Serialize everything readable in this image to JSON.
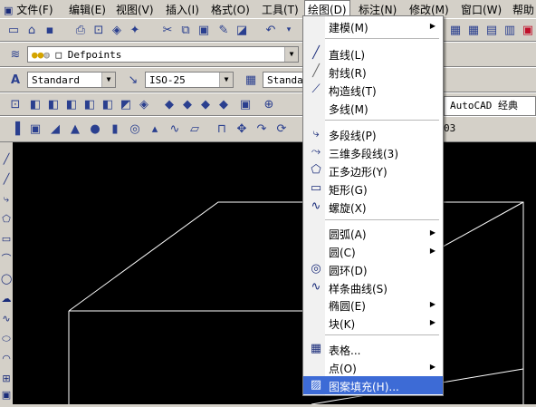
{
  "menubar": {
    "items": [
      "文件(F)",
      "编辑(E)",
      "视图(V)",
      "插入(I)",
      "格式(O)",
      "工具(T)",
      "绘图(D)",
      "标注(N)",
      "修改(M)",
      "窗口(W)",
      "帮助"
    ],
    "active_index": 6
  },
  "toolbars": {
    "layer_combo": "Defpoints",
    "text_style_combo": "Standard",
    "dim_style_combo": "ISO-25",
    "table_style_combo": "Standar",
    "workspace_combo": "AutoCAD 经典",
    "layer_icon_name": "layer-icon"
  },
  "draw_menu": {
    "items": [
      {
        "label": "建模(M)",
        "icon": "",
        "submenu": true
      },
      {
        "label": "直线(L)",
        "icon": "line-icon",
        "submenu": false
      },
      {
        "label": "射线(R)",
        "icon": "ray-icon",
        "submenu": false
      },
      {
        "label": "构造线(T)",
        "icon": "xline-icon",
        "submenu": false
      },
      {
        "label": "多线(M)",
        "icon": "",
        "submenu": false
      },
      {
        "label": "多段线(P)",
        "icon": "polyline-icon",
        "submenu": false
      },
      {
        "label": "三维多段线(3)",
        "icon": "3dpoly-icon",
        "submenu": false
      },
      {
        "label": "正多边形(Y)",
        "icon": "polygon-icon",
        "submenu": false
      },
      {
        "label": "矩形(G)",
        "icon": "rectangle-icon",
        "submenu": false
      },
      {
        "label": "螺旋(X)",
        "icon": "helix-icon",
        "submenu": false
      },
      {
        "label": "圆弧(A)",
        "icon": "",
        "submenu": true
      },
      {
        "label": "圆(C)",
        "icon": "",
        "submenu": true
      },
      {
        "label": "圆环(D)",
        "icon": "donut-icon",
        "submenu": false
      },
      {
        "label": "样条曲线(S)",
        "icon": "spline-icon",
        "submenu": false
      },
      {
        "label": "椭圆(E)",
        "icon": "",
        "submenu": true
      },
      {
        "label": "块(K)",
        "icon": "",
        "submenu": true
      },
      {
        "label": "表格...",
        "icon": "table-icon",
        "submenu": false
      },
      {
        "label": "点(O)",
        "icon": "",
        "submenu": true
      },
      {
        "label": "图案填充(H)...",
        "icon": "hatch-icon",
        "submenu": false,
        "highlighted": true
      }
    ]
  }
}
